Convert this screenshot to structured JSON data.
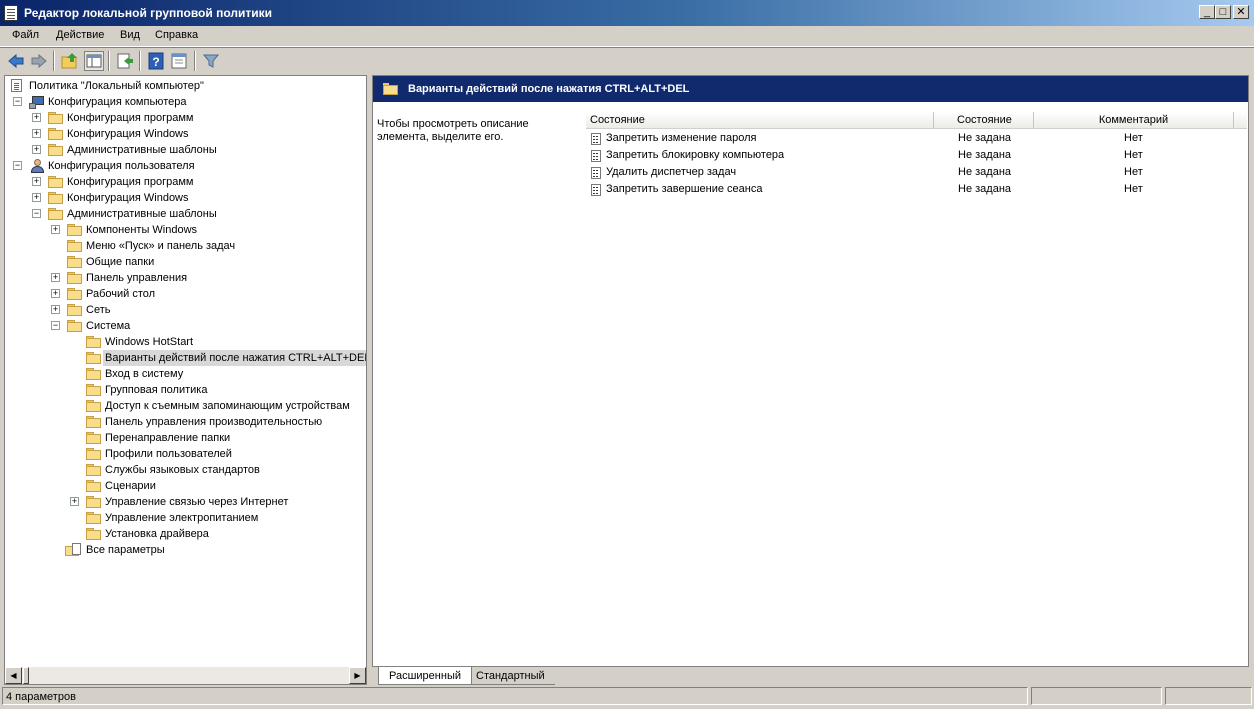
{
  "window": {
    "title": "Редактор локальной групповой политики",
    "minimize": "_",
    "maximize": "□",
    "close": "✕"
  },
  "menu": [
    "Файл",
    "Действие",
    "Вид",
    "Справка"
  ],
  "toolbar": [
    "back-icon",
    "forward-icon",
    "up-folder-icon",
    "show-hide-tree-icon",
    "export-icon",
    "help-icon",
    "properties-icon",
    "filter-icon"
  ],
  "tree": {
    "root": "Политика \"Локальный компьютер\"",
    "computer_config": "Конфигурация компьютера",
    "cc_programs": "Конфигурация программ",
    "cc_windows": "Конфигурация Windows",
    "cc_admin": "Административные шаблоны",
    "user_config": "Конфигурация пользователя",
    "uc_programs": "Конфигурация программ",
    "uc_windows": "Конфигурация Windows",
    "uc_admin": "Административные шаблоны",
    "windows_components": "Компоненты Windows",
    "start_menu": "Меню «Пуск» и панель задач",
    "shared_folders": "Общие папки",
    "control_panel": "Панель управления",
    "desktop": "Рабочий стол",
    "network": "Сеть",
    "system": "Система",
    "system_children": [
      "Windows HotStart",
      "Варианты действий после нажатия CTRL+ALT+DEL",
      "Вход в систему",
      "Групповая политика",
      "Доступ к съемным запоминающим устройствам",
      "Панель управления производительностью",
      "Перенаправление папки",
      "Профили пользователей",
      "Службы языковых стандартов",
      "Сценарии",
      "Управление связью через Интернет",
      "Управление электропитанием",
      "Установка драйвера"
    ],
    "all_params": "Все параметры"
  },
  "right": {
    "header_title": "Варианты действий после нажатия CTRL+ALT+DEL",
    "description": "Чтобы просмотреть описание элемента, выделите его.",
    "columns": [
      "Состояние",
      "Состояние",
      "Комментарий"
    ],
    "rows": [
      {
        "name": "Запретить изменение пароля",
        "state": "Не задана",
        "comment": "Нет"
      },
      {
        "name": "Запретить блокировку компьютера",
        "state": "Не задана",
        "comment": "Нет"
      },
      {
        "name": "Удалить диспетчер задач",
        "state": "Не задана",
        "comment": "Нет"
      },
      {
        "name": "Запретить завершение сеанса",
        "state": "Не задана",
        "comment": "Нет"
      }
    ]
  },
  "tabs": {
    "extended": "Расширенный",
    "standard": "Стандартный"
  },
  "status": {
    "text": "4 параметров"
  }
}
